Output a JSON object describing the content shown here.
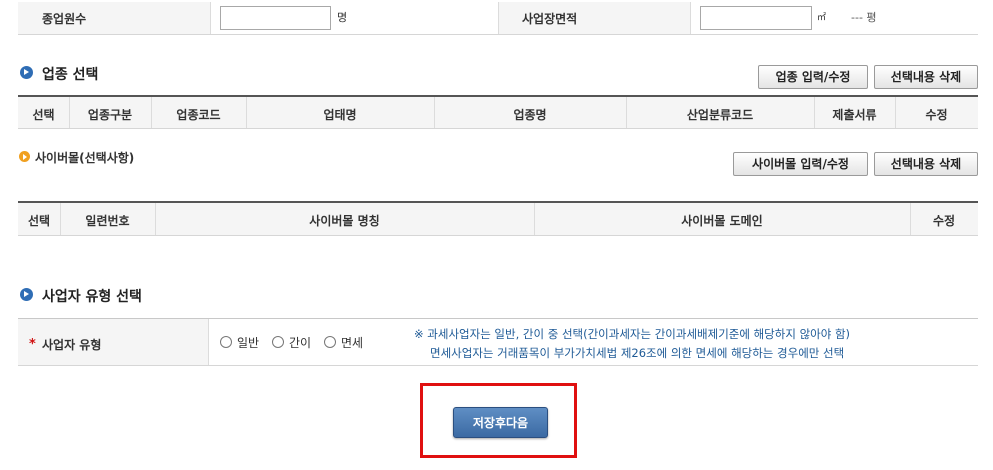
{
  "top_row": {
    "employees_label": "종업원수",
    "employees_value": "",
    "employees_unit": "명",
    "area_label": "사업장면적",
    "area_value": "",
    "area_unit": "㎡",
    "area_pyeong": "--- 평"
  },
  "industry": {
    "title": "업종 선택",
    "input_button": "업종 입력/수정",
    "delete_button": "선택내용 삭제",
    "columns": [
      "선택",
      "업종구분",
      "업종코드",
      "업태명",
      "업종명",
      "산업분류코드",
      "제출서류",
      "수정"
    ]
  },
  "cybermall": {
    "title": "사이버몰(선택사항)",
    "input_button": "사이버몰 입력/수정",
    "delete_button": "선택내용 삭제",
    "columns": [
      "선택",
      "일련번호",
      "사이버몰 명칭",
      "사이버몰 도메인",
      "수정"
    ]
  },
  "business_type": {
    "title": "사업자 유형 선택",
    "required_mark": "*",
    "field_label": "사업자 유형",
    "options": [
      "일반",
      "간이",
      "면세"
    ],
    "note_line1": "※ 과세사업자는 일반, 간이 중 선택(간이과세자는 간이과세배제기준에 해당하지 않아야 함)",
    "note_line2": "면세사업자는 거래품목이 부가가치세법 제26조에 의한 면세에 해당하는 경우에만 선택"
  },
  "footer": {
    "save_next_button": "저장후다음"
  },
  "colors": {
    "accent_blue": "#2f6db5",
    "note_blue": "#1e5a96",
    "highlight_red": "#e01010",
    "save_button": "#4a78b0"
  }
}
